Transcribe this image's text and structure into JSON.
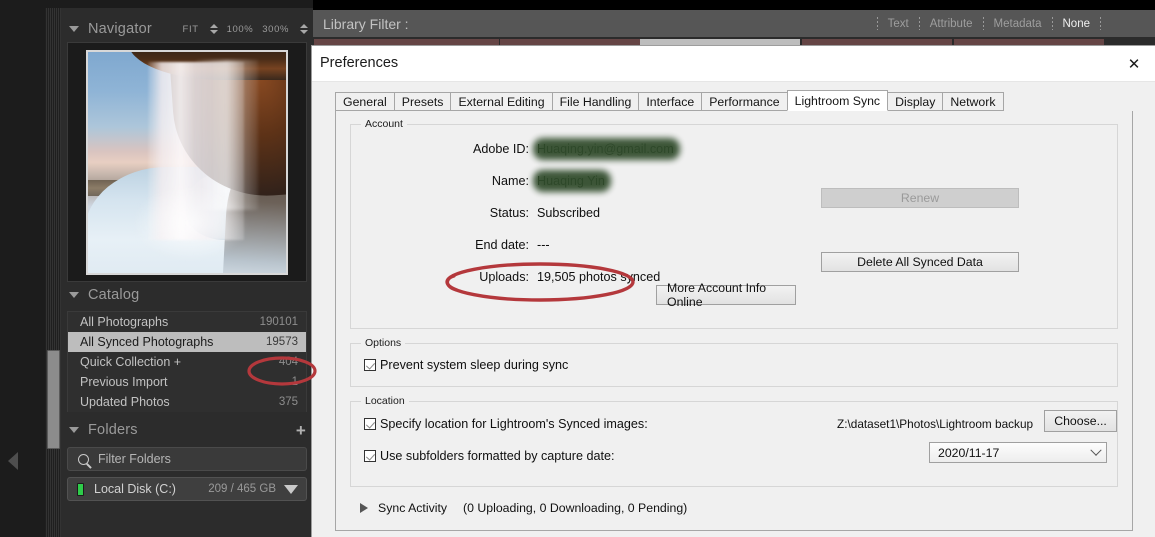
{
  "app": {
    "left_panel": {
      "navigator": {
        "title": "Navigator",
        "zoom_fit": "FIT",
        "zoom_100": "100%",
        "zoom_300": "300%"
      },
      "catalog": {
        "title": "Catalog",
        "items": [
          {
            "label": "All Photographs",
            "count": "190101",
            "selected": false
          },
          {
            "label": "All Synced Photographs",
            "count": "19573",
            "selected": true
          },
          {
            "label": "Quick Collection  +",
            "count": "404",
            "selected": false
          },
          {
            "label": "Previous Import",
            "count": "1",
            "selected": false
          },
          {
            "label": "Updated Photos",
            "count": "375",
            "selected": false
          }
        ]
      },
      "folders": {
        "title": "Folders",
        "add_icon": "+",
        "filter_placeholder": "Filter Folders",
        "disk": {
          "label": "Local Disk (C:)",
          "size": "209 / 465 GB"
        }
      }
    },
    "library_filter": {
      "title": "Library Filter :",
      "modes": [
        {
          "label": "Text",
          "active": false
        },
        {
          "label": "Attribute",
          "active": false
        },
        {
          "label": "Metadata",
          "active": false
        },
        {
          "label": "None",
          "active": true
        }
      ]
    }
  },
  "prefs": {
    "title": "Preferences",
    "close_glyph": "✕",
    "tabs": [
      {
        "label": "General",
        "active": false
      },
      {
        "label": "Presets",
        "active": false
      },
      {
        "label": "External Editing",
        "active": false
      },
      {
        "label": "File Handling",
        "active": false
      },
      {
        "label": "Interface",
        "active": false
      },
      {
        "label": "Performance",
        "active": false
      },
      {
        "label": "Lightroom Sync",
        "active": true
      },
      {
        "label": "Display",
        "active": false
      },
      {
        "label": "Network",
        "active": false
      }
    ],
    "account": {
      "legend": "Account",
      "adobe_id_label": "Adobe ID:",
      "adobe_id_value": "Huaqing.yin@gmail.com",
      "name_label": "Name:",
      "name_value": "Huaqing Yin",
      "status_label": "Status:",
      "status_value": "Subscribed",
      "end_date_label": "End date:",
      "end_date_value": "---",
      "uploads_label": "Uploads:",
      "uploads_value": "19,505 photos synced",
      "renew_button": "Renew",
      "delete_button": "Delete All Synced Data",
      "more_info_button": "More Account Info Online"
    },
    "options": {
      "legend": "Options",
      "prevent_sleep_label": "Prevent system sleep during sync",
      "prevent_sleep_checked": true
    },
    "location": {
      "legend": "Location",
      "specify_location_label": "Specify location for Lightroom's Synced images:",
      "specify_location_checked": true,
      "location_path": "Z:\\dataset1\\Photos\\Lightroom backup",
      "choose_button": "Choose...",
      "subfolders_label": "Use subfolders formatted by capture date:",
      "subfolders_checked": true,
      "date_format_value": "2020/11-17"
    },
    "sync_activity": {
      "label": "Sync Activity",
      "status": "(0 Uploading, 0 Downloading, 0 Pending)"
    }
  },
  "annotations": {
    "accent_color": "#b4383c",
    "ellipse_uploads": "highlights the Uploads synced count",
    "ellipse_catalog_count": "highlights the All Synced Photographs count"
  }
}
